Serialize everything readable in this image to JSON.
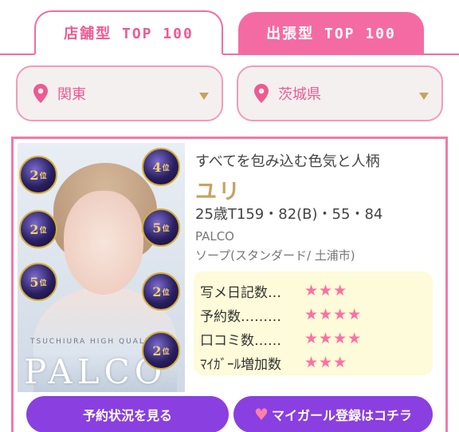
{
  "tabs": {
    "shop": "店舗型 TOP 100",
    "delivery": "出張型 TOP 100"
  },
  "filters": {
    "region": "関東",
    "prefecture": "茨城県"
  },
  "card": {
    "catchphrase": "すべてを包み込む色気と人柄",
    "name": "ユリ",
    "profile": "25歳T159・82(B)・55・84",
    "shop": "PALCO",
    "genre": "ソープ(スタンダード/ 土浦市)",
    "photo_brand": "PALCO",
    "photo_tag": "TSUCHIURA HIGH QUALITY",
    "badges": [
      {
        "rank": "2",
        "suffix": "位"
      },
      {
        "rank": "2",
        "suffix": "位"
      },
      {
        "rank": "5",
        "suffix": "位"
      },
      {
        "rank": "4",
        "suffix": "位"
      },
      {
        "rank": "5",
        "suffix": "位"
      },
      {
        "rank": "2",
        "suffix": "位"
      },
      {
        "rank": "2",
        "suffix": "位"
      }
    ],
    "ratings": [
      {
        "label": "写メ日記数…",
        "stars": "★★★"
      },
      {
        "label": "予約数………",
        "stars": "★★★★"
      },
      {
        "label": "口コミ数……",
        "stars": "★★★★"
      },
      {
        "label": "ﾏｲｶﾞｰﾙ増加数",
        "stars": "★★★"
      }
    ],
    "buttons": {
      "reserve": "予約状況を見る",
      "mygirl": "マイガール登録はコチラ"
    }
  },
  "colors": {
    "accent_pink": "#f06ea0",
    "button_purple": "#8a3fe0",
    "name_gold": "#c8a262",
    "star_pink": "#ff6fa3"
  }
}
